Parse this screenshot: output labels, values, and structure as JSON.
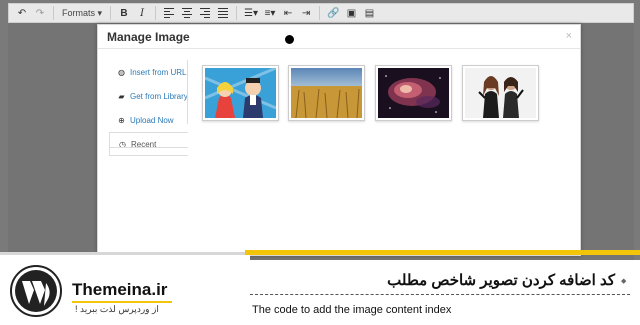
{
  "toolbar": {
    "formats_label": "Formats",
    "bold_label": "B",
    "italic_label": "I"
  },
  "modal": {
    "title": "Manage Image",
    "close_glyph": "×",
    "nav": [
      {
        "label": "Insert from URL",
        "icon": "globe-icon",
        "glyph": "🌐"
      },
      {
        "label": "Get from Library",
        "icon": "folder-open-icon",
        "glyph": "📂"
      },
      {
        "label": "Upload Now",
        "icon": "upload-icon",
        "glyph": "⊕"
      },
      {
        "label": "Recent",
        "icon": "clock-icon",
        "glyph": "◷"
      }
    ],
    "active_nav": "Recent",
    "thumbnails": [
      "cartoon-family-image",
      "wheat-field-image",
      "nebula-image",
      "two-women-image"
    ]
  },
  "banner": {
    "site_name": "Themeina.ir",
    "tagline": "از وردپرس لذت ببرید !",
    "title_fa": "کد اضافه کردن تصویر شاخص مطلب",
    "title_en": "The code to add the image content index",
    "marker": "◆",
    "accent_color": "#f2c40a"
  }
}
